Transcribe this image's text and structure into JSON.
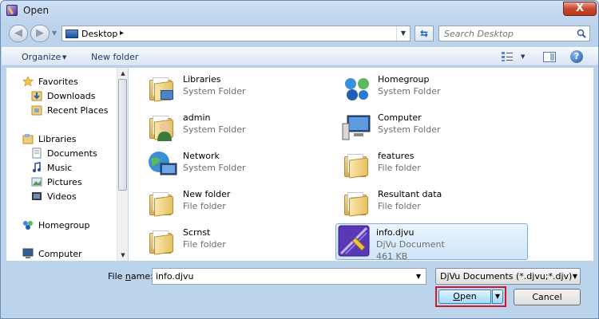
{
  "window": {
    "title": "Open",
    "close_glyph": "X"
  },
  "address_bar": {
    "location": "Desktop"
  },
  "search": {
    "placeholder": "Search Desktop"
  },
  "toolbar": {
    "organize_label": "Organize",
    "new_folder_label": "New folder"
  },
  "sidebar": {
    "favorites_label": "Favorites",
    "favorites": [
      {
        "label": "Downloads",
        "icon": "downloads-icon"
      },
      {
        "label": "Recent Places",
        "icon": "recent-places-icon"
      }
    ],
    "libraries_label": "Libraries",
    "libraries": [
      {
        "label": "Documents",
        "icon": "documents-icon"
      },
      {
        "label": "Music",
        "icon": "music-icon"
      },
      {
        "label": "Pictures",
        "icon": "pictures-icon"
      },
      {
        "label": "Videos",
        "icon": "videos-icon"
      }
    ],
    "homegroup_label": "Homegroup",
    "computer_label": "Computer"
  },
  "items": [
    {
      "name": "Libraries",
      "type": "System Folder",
      "icon": "libraries-icon"
    },
    {
      "name": "Homegroup",
      "type": "System Folder",
      "icon": "homegroup-icon"
    },
    {
      "name": "admin",
      "type": "System Folder",
      "icon": "user-folder-icon"
    },
    {
      "name": "Computer",
      "type": "System Folder",
      "icon": "computer-icon"
    },
    {
      "name": "Network",
      "type": "System Folder",
      "icon": "network-icon"
    },
    {
      "name": "features",
      "type": "File folder",
      "icon": "folder-icon"
    },
    {
      "name": "New folder",
      "type": "File folder",
      "icon": "folder-icon"
    },
    {
      "name": "Resultant data",
      "type": "File folder",
      "icon": "folder-icon"
    },
    {
      "name": "Scrnst",
      "type": "File folder",
      "icon": "folder-icon"
    },
    {
      "name": "info.djvu",
      "type": "DjVu Document",
      "size": "461 KB",
      "icon": "djvu-file-icon",
      "selected": true
    }
  ],
  "footer": {
    "file_name_label_pre": "File ",
    "file_name_label_accel": "n",
    "file_name_label_post": "ame:",
    "file_name_value": "info.djvu",
    "file_type_value": "DjVu Documents (*.djvu;*.djv)",
    "open_label_accel": "O",
    "open_label_post": "pen",
    "cancel_label": "Cancel"
  },
  "colors": {
    "accent": "#3c7fb1",
    "highlight": "#d0182a"
  }
}
